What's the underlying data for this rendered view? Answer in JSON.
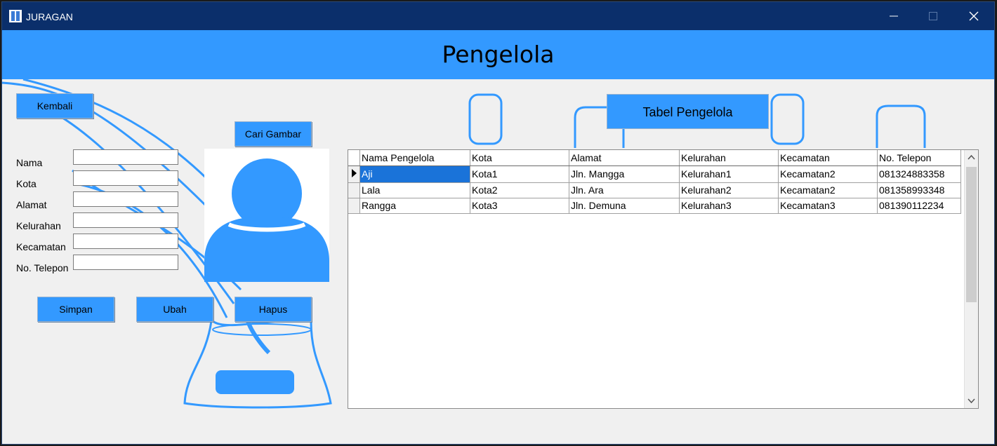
{
  "window": {
    "title": "JURAGAN"
  },
  "header": {
    "title": "Pengelola"
  },
  "buttons": {
    "back": "Kembali",
    "browse_image": "Cari Gambar",
    "save": "Simpan",
    "edit": "Ubah",
    "delete": "Hapus"
  },
  "form": {
    "labels": [
      "Nama",
      "Kota",
      "Alamat",
      "Kelurahan",
      "Kecamatan",
      "No. Telepon"
    ],
    "values": [
      "",
      "",
      "",
      "",
      "",
      ""
    ]
  },
  "table": {
    "title": "Tabel Pengelola",
    "columns": [
      "Nama Pengelola",
      "Kota",
      "Alamat",
      "Kelurahan",
      "Kecamatan",
      "No. Telepon"
    ],
    "rows": [
      [
        "Aji",
        "Kota1",
        "Jln. Mangga",
        "Kelurahan1",
        "Kecamatan2",
        "081324883358"
      ],
      [
        "Lala",
        "Kota2",
        "Jln. Ara",
        "Kelurahan2",
        "Kecamatan2",
        "081358993348"
      ],
      [
        "Rangga",
        "Kota3",
        "Jln. Demuna",
        "Kelurahan3",
        "Kecamatan3",
        "081390112234"
      ]
    ],
    "selected_row": 0
  },
  "icons": {
    "app": "app-logo-icon",
    "avatar": "user-avatar-icon",
    "minimize": "minimize-icon",
    "maximize": "maximize-icon",
    "close": "close-icon"
  },
  "colors": {
    "accent": "#3399ff",
    "titlebar": "#0b2f6b",
    "selection": "#1a73d9"
  }
}
